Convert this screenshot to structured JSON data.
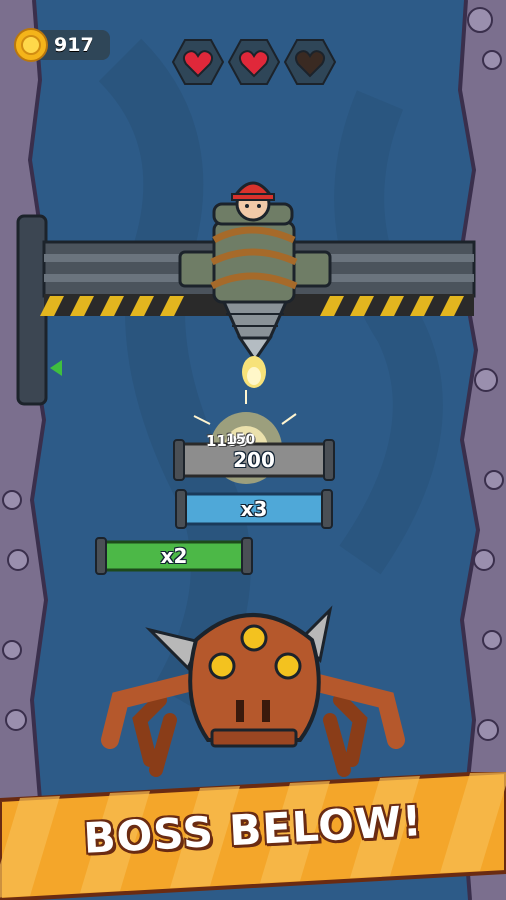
{
  "hud": {
    "coins": "917",
    "hearts": [
      {
        "state": "full",
        "icon": "heart-icon"
      },
      {
        "state": "full",
        "icon": "heart-icon"
      },
      {
        "state": "empty",
        "icon": "heart-empty-icon"
      }
    ]
  },
  "bars": [
    {
      "name": "score-bar",
      "label": "200",
      "color": "#9a9a9a"
    },
    {
      "name": "multiplier-bar-x3",
      "label": "x3",
      "color": "#4fa8d8"
    },
    {
      "name": "multiplier-bar-x2",
      "label": "x2",
      "color": "#4cb847"
    }
  ],
  "popups": {
    "overlap_a": "150",
    "overlap_b": "1100"
  },
  "banner": {
    "text": "BOSS BELOW!"
  },
  "colors": {
    "cave": "#2c5a86",
    "rock": "#7a6f8c",
    "banner": "#f4a62a",
    "boss": "#b5582c"
  }
}
